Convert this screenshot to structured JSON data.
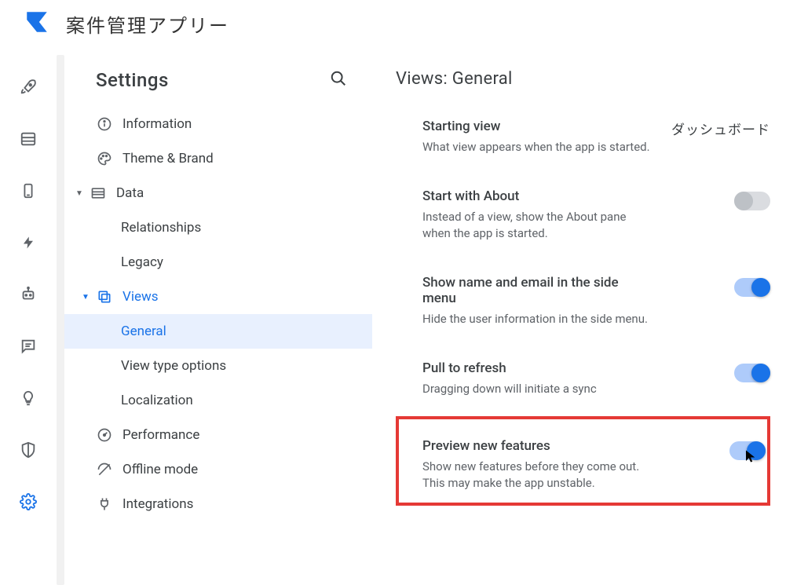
{
  "app": {
    "title": "案件管理アプリー"
  },
  "sidebar": {
    "header": "Settings",
    "items": {
      "information": "Information",
      "theme": "Theme & Brand",
      "data": "Data",
      "relationships": "Relationships",
      "legacy": "Legacy",
      "views": "Views",
      "general": "General",
      "view_type_options": "View type options",
      "localization": "Localization",
      "performance": "Performance",
      "offline_mode": "Offline mode",
      "integrations": "Integrations"
    }
  },
  "content": {
    "heading": "Views: General",
    "settings": {
      "starting_view": {
        "title": "Starting view",
        "desc": "What view appears when the app is started.",
        "value": "ダッシュボード"
      },
      "start_with_about": {
        "title": "Start with About",
        "desc": "Instead of a view, show the About pane when the app is started.",
        "on": false
      },
      "show_name_email": {
        "title": "Show name and email in the side menu",
        "desc": "Hide the user information in the side menu.",
        "on": true
      },
      "pull_to_refresh": {
        "title": "Pull to refresh",
        "desc": "Dragging down will initiate a sync",
        "on": true
      },
      "preview_new_features": {
        "title": "Preview new features",
        "desc": "Show new features before they come out. This may make the app unstable.",
        "on": true
      }
    }
  }
}
